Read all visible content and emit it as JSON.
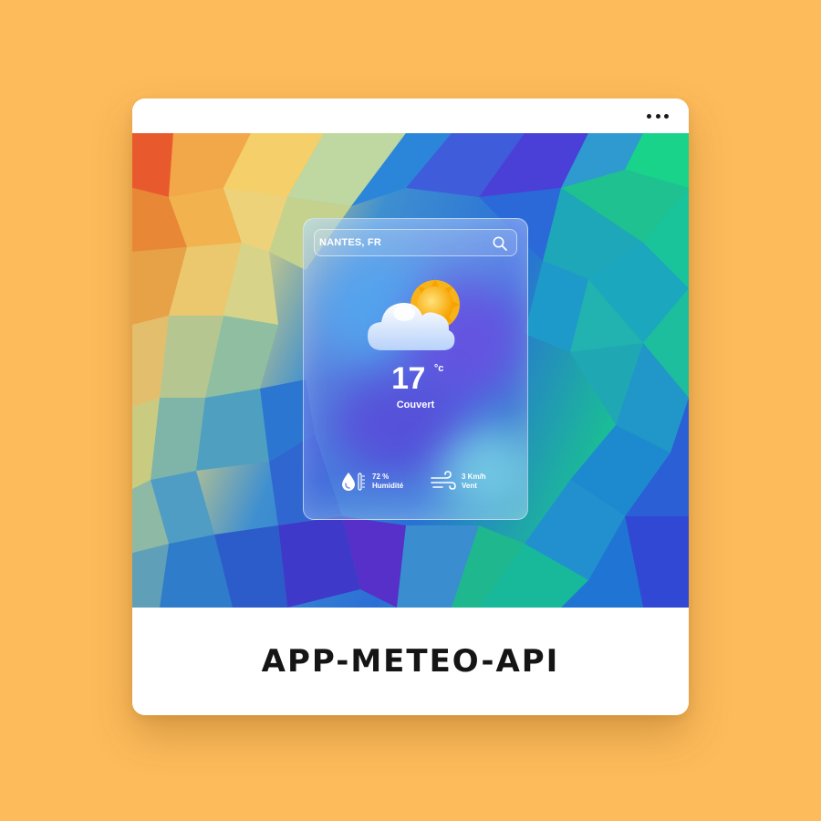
{
  "widget": {
    "location": "NANTES, FR",
    "temperature": "17",
    "unit": "°c",
    "condition": "Couvert",
    "humidity": {
      "value": "72 %",
      "label": "Humidité",
      "icon": "humidity-icon"
    },
    "wind": {
      "value": "3 Km/h",
      "label": "Vent",
      "icon": "wind-icon"
    },
    "weather_icon": "partly-cloudy-icon",
    "search_icon": "search-icon"
  },
  "window": {
    "menu_icon": "more-horizontal-icon"
  },
  "caption": {
    "title": "APP-METEO-API"
  },
  "colors": {
    "page_background": "#FDBB5B",
    "card_background": "#FFFFFF",
    "text_primary": "#151515",
    "widget_text": "#FFFFFF",
    "sun": "#F6A300",
    "cloud": "#D9E8FF"
  }
}
